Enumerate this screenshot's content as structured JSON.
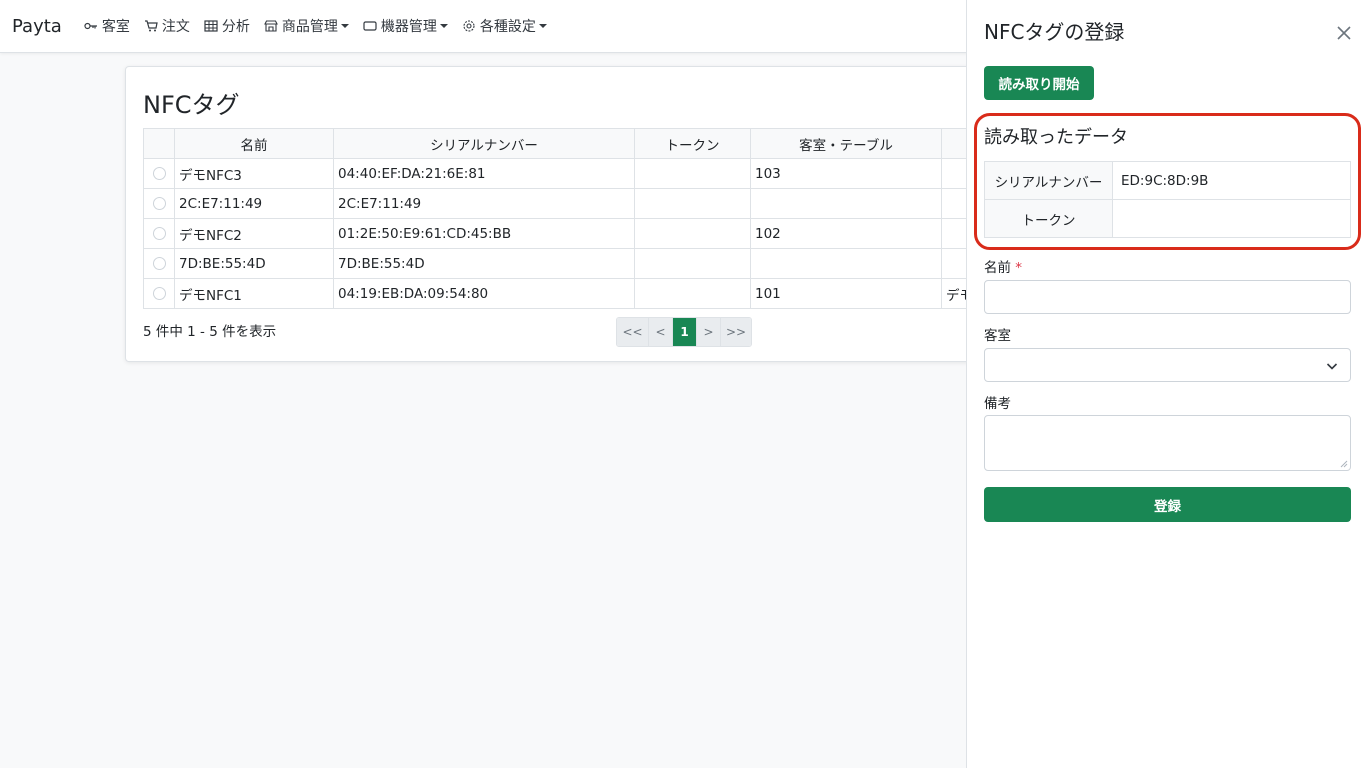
{
  "navbar": {
    "brand": "Payta",
    "items": [
      {
        "label": "客室",
        "icon": "key-icon",
        "dropdown": false
      },
      {
        "label": "注文",
        "icon": "cart-icon",
        "dropdown": false
      },
      {
        "label": "分析",
        "icon": "table-icon",
        "dropdown": false
      },
      {
        "label": "商品管理",
        "icon": "shop-icon",
        "dropdown": true
      },
      {
        "label": "機器管理",
        "icon": "device-icon",
        "dropdown": true
      },
      {
        "label": "各種設定",
        "icon": "gear-icon",
        "dropdown": true
      }
    ]
  },
  "list": {
    "title": "NFCタグ",
    "columns": [
      "名前",
      "シリアルナンバー",
      "トークン",
      "客室・テーブル",
      ""
    ],
    "rows": [
      {
        "name": "デモNFC3",
        "serial": "04:40:EF:DA:21:6E:81",
        "token": "",
        "room": "103",
        "extra": ""
      },
      {
        "name": "2C:E7:11:49",
        "serial": "2C:E7:11:49",
        "token": "",
        "room": "",
        "extra": ""
      },
      {
        "name": "デモNFC2",
        "serial": "01:2E:50:E9:61:CD:45:BB",
        "token": "",
        "room": "102",
        "extra": ""
      },
      {
        "name": "7D:BE:55:4D",
        "serial": "7D:BE:55:4D",
        "token": "",
        "room": "",
        "extra": ""
      },
      {
        "name": "デモNFC1",
        "serial": "04:19:EB:DA:09:54:80",
        "token": "",
        "room": "101",
        "extra": "デモ"
      }
    ],
    "count_text": "5 件中 1 - 5 件を表示",
    "pager": {
      "first": "<<",
      "prev": "<",
      "current": "1",
      "next": ">",
      "last": ">>"
    }
  },
  "panel": {
    "title": "NFCタグの登録",
    "read_button": "読み取り開始",
    "read_section_title": "読み取ったデータ",
    "read_rows": [
      {
        "label": "シリアルナンバー",
        "value": "ED:9C:8D:9B"
      },
      {
        "label": "トークン",
        "value": ""
      }
    ],
    "name_label": "名前",
    "required_mark": "*",
    "name_value": "",
    "room_label": "客室",
    "room_value": "",
    "note_label": "備考",
    "note_value": "",
    "submit": "登録"
  },
  "colors": {
    "accent": "#198754",
    "highlight": "#d92b1a"
  }
}
